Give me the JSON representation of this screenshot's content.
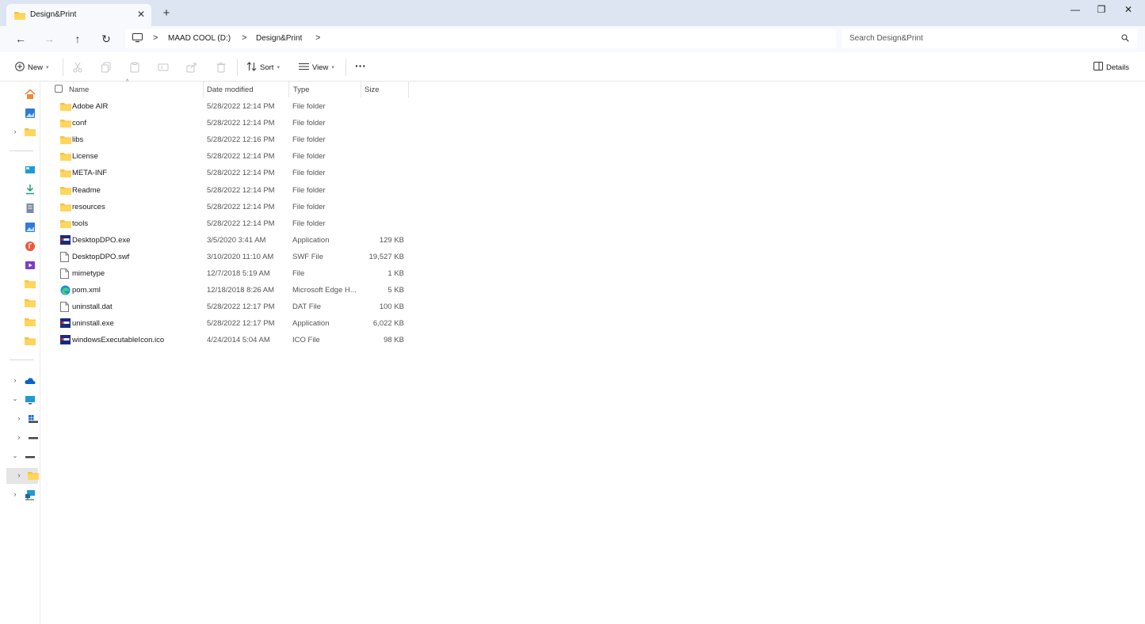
{
  "window": {
    "tab_title": "Design&Print",
    "tab_close": "✕",
    "new_tab": "+",
    "minimize": "—",
    "maximize": "❐",
    "close": "✕"
  },
  "nav": {
    "back": "←",
    "forward": "→",
    "up": "↑",
    "refresh": "↻"
  },
  "breadcrumb": {
    "items": [
      "MAAD COOL (D:)",
      "Design&Print"
    ],
    "separator": ">"
  },
  "search": {
    "placeholder": "Search Design&Print"
  },
  "commands": {
    "new_label": "New",
    "sort_label": "Sort",
    "view_label": "View",
    "more_label": "···",
    "details_label": "Details"
  },
  "columns": {
    "name": "Name",
    "date": "Date modified",
    "type": "Type",
    "size": "Size"
  },
  "files": [
    {
      "name": "Adobe AIR",
      "date": "5/28/2022 12:14 PM",
      "type": "File folder",
      "size": "",
      "icon": "folder-icon"
    },
    {
      "name": "conf",
      "date": "5/28/2022 12:14 PM",
      "type": "File folder",
      "size": "",
      "icon": "folder-icon"
    },
    {
      "name": "libs",
      "date": "5/28/2022 12:16 PM",
      "type": "File folder",
      "size": "",
      "icon": "folder-icon"
    },
    {
      "name": "License",
      "date": "5/28/2022 12:14 PM",
      "type": "File folder",
      "size": "",
      "icon": "folder-icon"
    },
    {
      "name": "META-INF",
      "date": "5/28/2022 12:14 PM",
      "type": "File folder",
      "size": "",
      "icon": "folder-icon"
    },
    {
      "name": "Readme",
      "date": "5/28/2022 12:14 PM",
      "type": "File folder",
      "size": "",
      "icon": "folder-icon"
    },
    {
      "name": "resources",
      "date": "5/28/2022 12:14 PM",
      "type": "File folder",
      "size": "",
      "icon": "folder-icon"
    },
    {
      "name": "tools",
      "date": "5/28/2022 12:14 PM",
      "type": "File folder",
      "size": "",
      "icon": "folder-icon"
    },
    {
      "name": "DesktopDPO.exe",
      "date": "3/5/2020 3:41 AM",
      "type": "Application",
      "size": "129 KB",
      "icon": "app-icon"
    },
    {
      "name": "DesktopDPO.swf",
      "date": "3/10/2020 11:10 AM",
      "type": "SWF File",
      "size": "19,527 KB",
      "icon": "file-icon"
    },
    {
      "name": "mimetype",
      "date": "12/7/2018 5:19 AM",
      "type": "File",
      "size": "1 KB",
      "icon": "file-icon"
    },
    {
      "name": "pom.xml",
      "date": "12/18/2018 8:26 AM",
      "type": "Microsoft Edge H...",
      "size": "5 KB",
      "icon": "edge-icon"
    },
    {
      "name": "uninstall.dat",
      "date": "5/28/2022 12:17 PM",
      "type": "DAT File",
      "size": "100 KB",
      "icon": "file-icon"
    },
    {
      "name": "uninstall.exe",
      "date": "5/28/2022 12:17 PM",
      "type": "Application",
      "size": "6,022 KB",
      "icon": "app-icon"
    },
    {
      "name": "windowsExecutableIcon.ico",
      "date": "4/24/2014 5:04 AM",
      "type": "ICO File",
      "size": "98 KB",
      "icon": "app-icon"
    }
  ],
  "colors": {
    "titlebar": "#dce5f1",
    "folder": "#f5c33b",
    "accent": "#0a64c8"
  }
}
